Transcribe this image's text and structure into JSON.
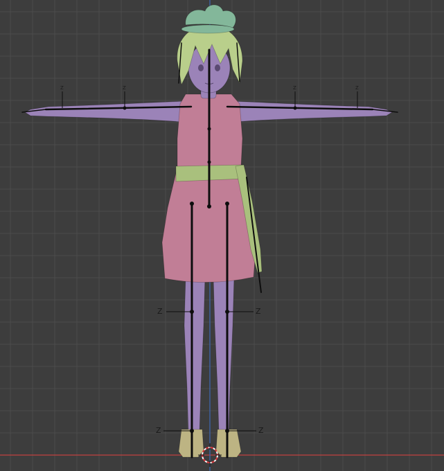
{
  "viewport": {
    "background_color": "#3d3d3d",
    "grid_color": "#4b4b4b",
    "x_axis_color": "#c2413f",
    "y_axis_color": "#3e67b3",
    "axis_label": "Z",
    "armature_color": "#0d0d0d",
    "materials": {
      "skin": "#9b83b8",
      "dress": "#c17e96",
      "hair": "#b9cf8b",
      "hair_accessory": "#83b79a",
      "belt": "#a9c07d",
      "shoes": "#bdb483"
    },
    "icons": [
      "3d-cursor-icon"
    ]
  }
}
